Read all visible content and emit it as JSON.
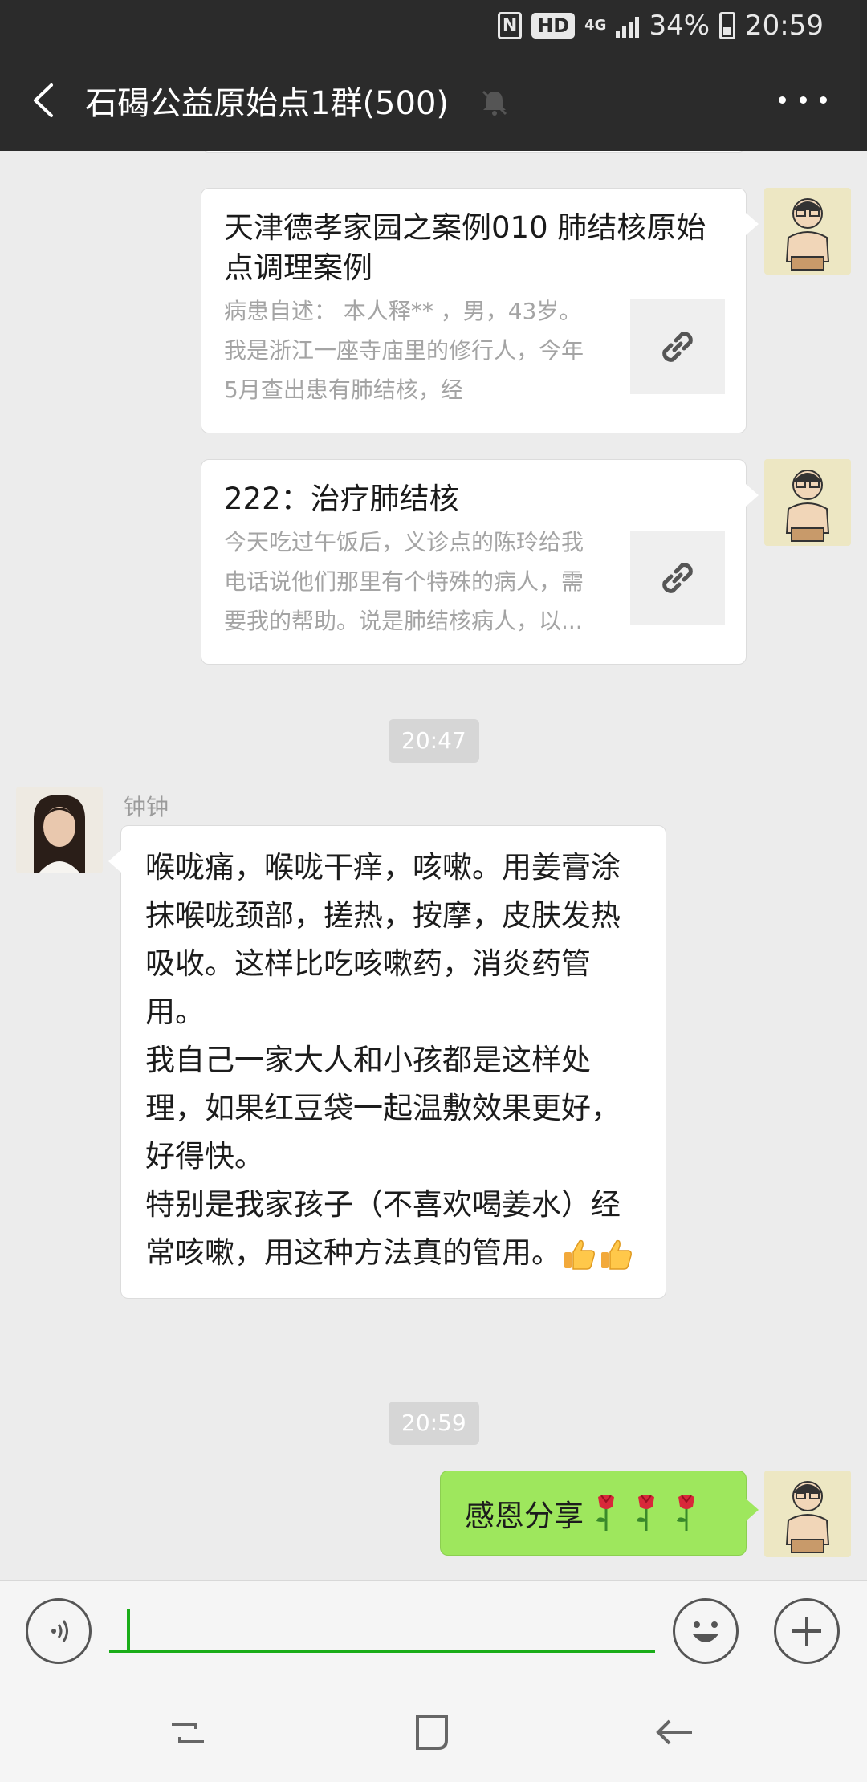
{
  "status_bar": {
    "nfc": "N",
    "hd": "HD",
    "network": "4G",
    "battery_percent": "34%",
    "time": "20:59"
  },
  "header": {
    "title": "石碣公益原始点1群(500)"
  },
  "messages": {
    "link_card_1": {
      "title": "天津德孝家园之案例010 肺结核原始点调理案例",
      "desc_lines": [
        "病患自述： 本人释** ，男，43岁。",
        "我是浙江一座寺庙里的修行人，今年",
        "5月查出患有肺结核，经"
      ]
    },
    "link_card_2": {
      "title": "222：治疗肺结核",
      "desc_lines": [
        "今天吃过午饭后，义诊点的陈玲给我",
        "电话说他们那里有个特殊的病人，需",
        "要我的帮助。说是肺结核病人，以..."
      ]
    },
    "timestamp_1": "20:47",
    "incoming": {
      "sender": "钟钟",
      "paragraphs": [
        "喉咙痛，喉咙干痒，咳嗽。用姜膏涂抹喉咙颈部，搓热，按摩，皮肤发热吸收。这样比吃咳嗽药，消炎药管用。",
        "我自己一家大人和小孩都是这样处理，如果红豆袋一起温敷效果更好，好得快。",
        "特别是我家孩子（不喜欢喝姜水）经常咳嗽，用这种方法真的管用。"
      ]
    },
    "timestamp_2": "20:59",
    "outgoing": {
      "text": "感恩分享",
      "emoji_count": 3
    }
  },
  "icons": {
    "back": "back-arrow-icon",
    "mute": "muted-bell-icon",
    "more": "more-dots-icon",
    "link": "link-icon",
    "thumbs_up": "thumbs-up-icon",
    "rose": "rose-icon",
    "voice": "voice-icon",
    "emoji": "emoji-icon",
    "plus": "plus-icon"
  },
  "colors": {
    "header_bg": "#2b2b2b",
    "chat_bg": "#ececec",
    "outgoing_bubble": "#9ee75d",
    "input_accent": "#1aad19"
  }
}
